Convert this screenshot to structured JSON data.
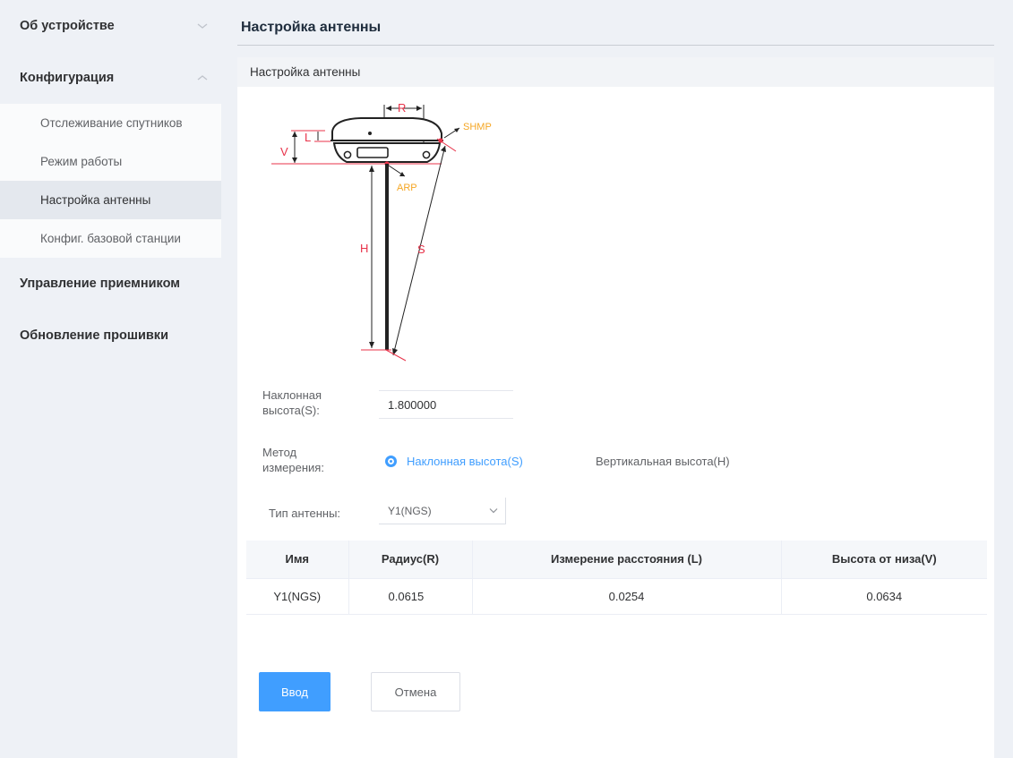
{
  "sidebar": {
    "groups": [
      {
        "label": "Об устройстве"
      },
      {
        "label": "Конфигурация"
      },
      {
        "label": "Управление приемником"
      },
      {
        "label": "Обновление прошивки"
      }
    ],
    "config_items": [
      {
        "label": "Отслеживание спутников"
      },
      {
        "label": "Режим работы"
      },
      {
        "label": "Настройка антенны"
      },
      {
        "label": "Конфиг. базовой станции"
      }
    ]
  },
  "page": {
    "title": "Настройка антенны",
    "section_title": "Настройка антенны"
  },
  "diagram": {
    "labels": {
      "R": "R",
      "L": "L",
      "V": "V",
      "H": "H",
      "S": "S",
      "shmp": "SHMP",
      "arp": "ARP"
    },
    "colors": {
      "dimension": "#e8334a",
      "callout": "#f5a623",
      "device": "#222222"
    }
  },
  "form": {
    "slant_height": {
      "label_line1": "Наклонная",
      "label_line2": "высота(S):",
      "value": "1.800000"
    },
    "method": {
      "label_line1": "Метод",
      "label_line2": "измерения:",
      "options": [
        {
          "label": "Наклонная высота(S)",
          "checked": true
        },
        {
          "label": "Вертикальная высота(H)",
          "checked": false
        }
      ]
    },
    "antenna_type": {
      "label": "Тип антенны:",
      "value": "Y1(NGS)"
    }
  },
  "table": {
    "headers": [
      "Имя",
      "Радиус(R)",
      "Измерение расстояния (L)",
      "Высота от низа(V)"
    ],
    "rows": [
      [
        "Y1(NGS)",
        "0.0615",
        "0.0254",
        "0.0634"
      ]
    ]
  },
  "buttons": {
    "submit": "Ввод",
    "cancel": "Отмена"
  },
  "colors": {
    "accent": "#409eff",
    "sidebar_bg": "#eef1f6",
    "active_item_bg": "#e4e8ee"
  }
}
